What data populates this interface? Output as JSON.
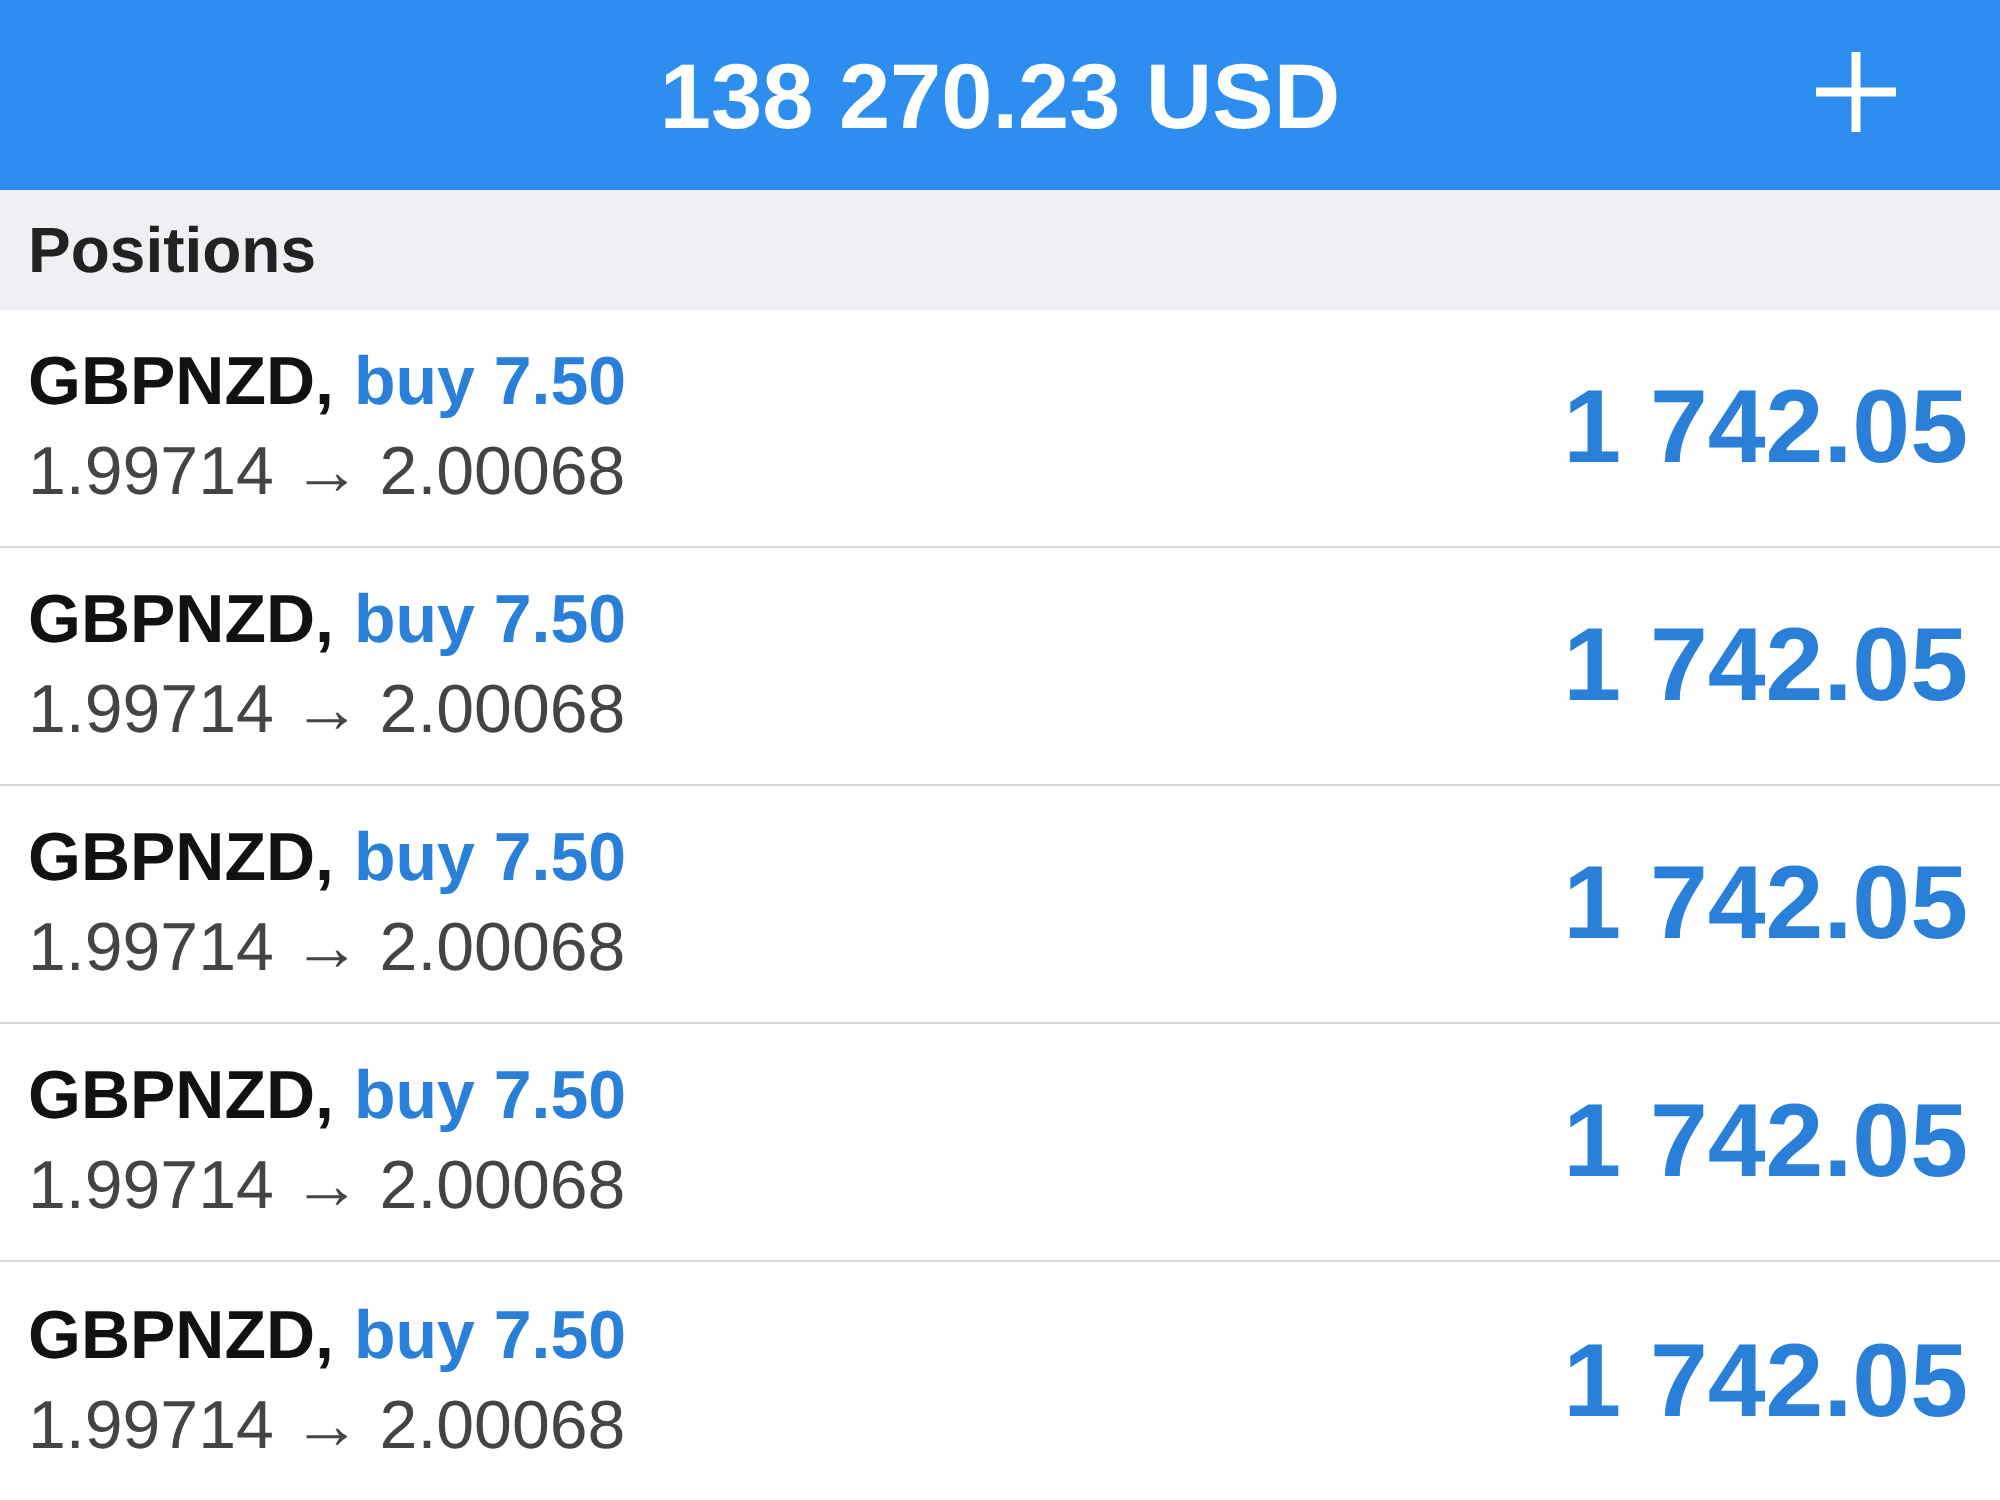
{
  "header": {
    "balance": "138 270.23 USD"
  },
  "section": {
    "title": "Positions"
  },
  "positions": [
    {
      "symbol": "GBPNZD,",
      "order": "buy 7.50",
      "prices": "1.99714 → 2.00068",
      "profit": "1 742.05"
    },
    {
      "symbol": "GBPNZD,",
      "order": "buy 7.50",
      "prices": "1.99714 → 2.00068",
      "profit": "1 742.05"
    },
    {
      "symbol": "GBPNZD,",
      "order": "buy 7.50",
      "prices": "1.99714 → 2.00068",
      "profit": "1 742.05"
    },
    {
      "symbol": "GBPNZD,",
      "order": "buy 7.50",
      "prices": "1.99714 → 2.00068",
      "profit": "1 742.05"
    },
    {
      "symbol": "GBPNZD,",
      "order": "buy 7.50",
      "prices": "1.99714 → 2.00068",
      "profit": "1 742.05"
    }
  ]
}
